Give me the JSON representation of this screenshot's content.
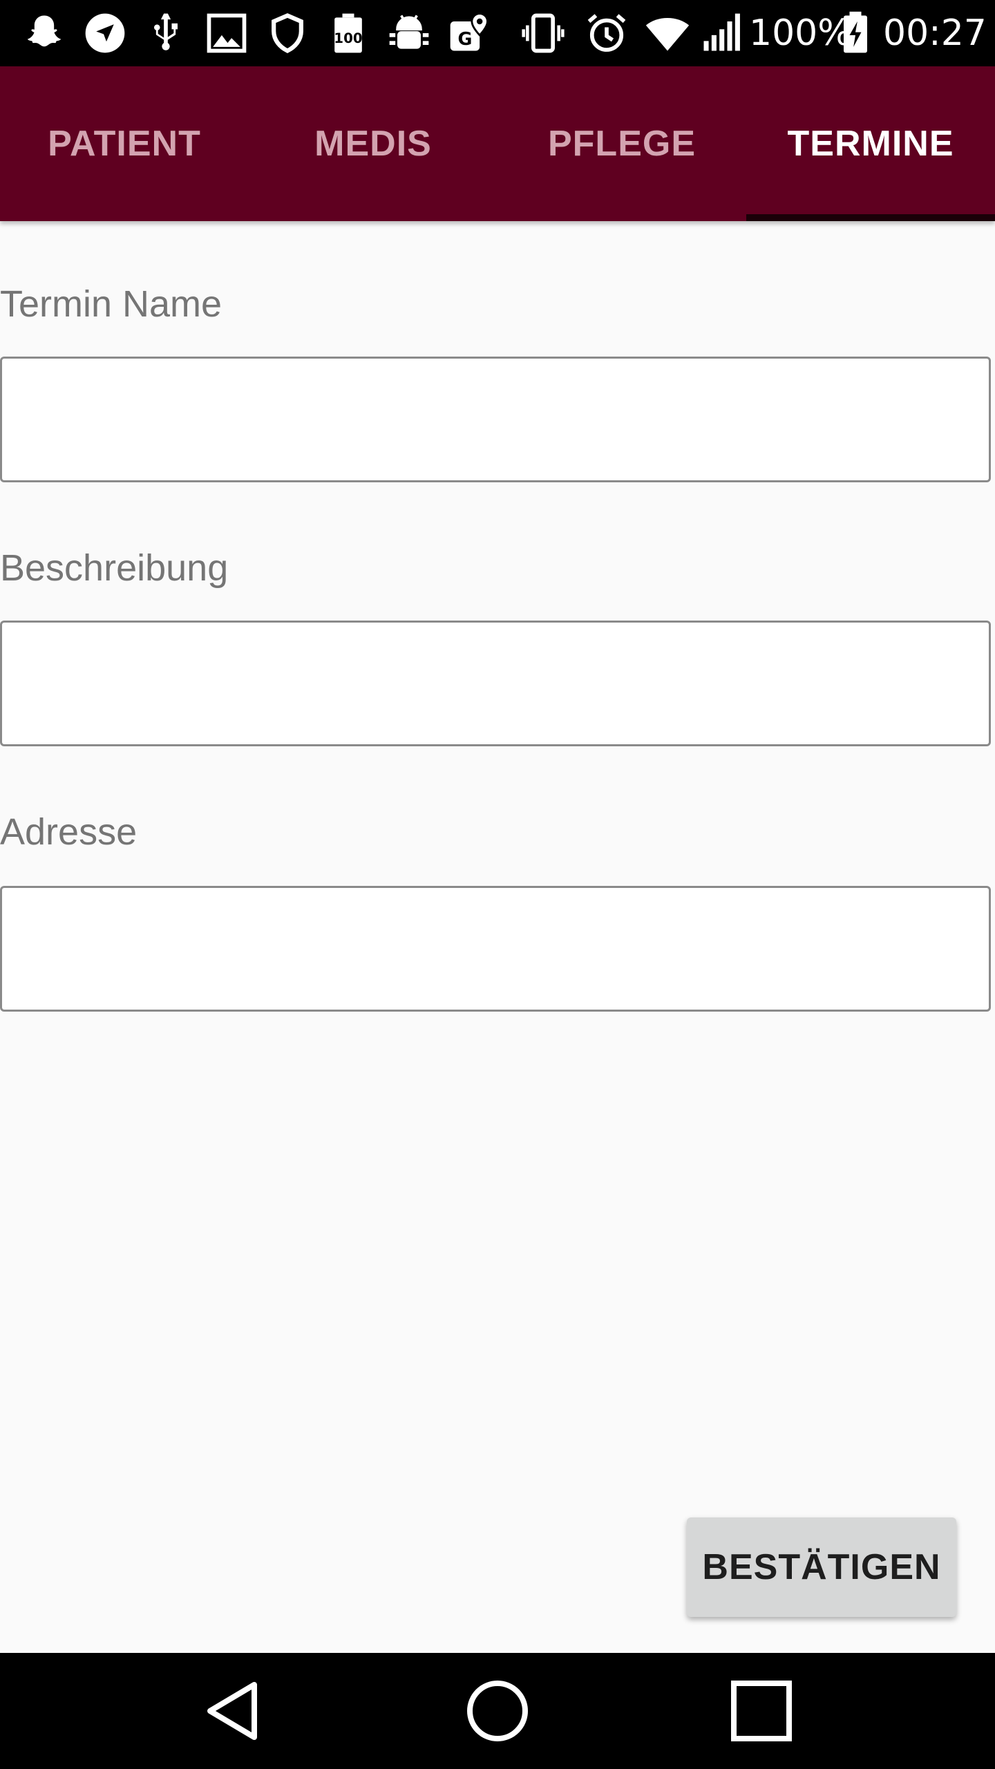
{
  "status_bar": {
    "icons": [
      "snapchat-icon",
      "navigation-icon",
      "usb-icon",
      "image-icon",
      "shield-icon",
      "battery-100-icon",
      "android-debug-icon",
      "maps-icon",
      "vibrate-icon",
      "alarm-icon",
      "wifi-icon",
      "signal-icon",
      "battery-charging-icon"
    ],
    "battery_percent": "100%",
    "time": "00:27"
  },
  "tabs": [
    {
      "label": "PATIENT"
    },
    {
      "label": "MEDIS"
    },
    {
      "label": "PFLEGE"
    },
    {
      "label": "TERMINE"
    }
  ],
  "active_tab": "TERMINE",
  "form": {
    "fields": [
      {
        "label": "Termin Name",
        "value": ""
      },
      {
        "label": "Beschreibung",
        "value": ""
      },
      {
        "label": "Adresse",
        "value": ""
      }
    ],
    "confirm_label": "BESTÄTIGEN"
  },
  "nav_bar": {
    "buttons": [
      "back-icon",
      "home-icon",
      "recents-icon"
    ]
  },
  "colors": {
    "tab_bar_bg": "#5f0020",
    "tab_inactive_text": "#d3a3b0",
    "tab_active_text": "#ffffff",
    "page_bg": "#fafafa",
    "button_bg": "#d6d7d7"
  }
}
